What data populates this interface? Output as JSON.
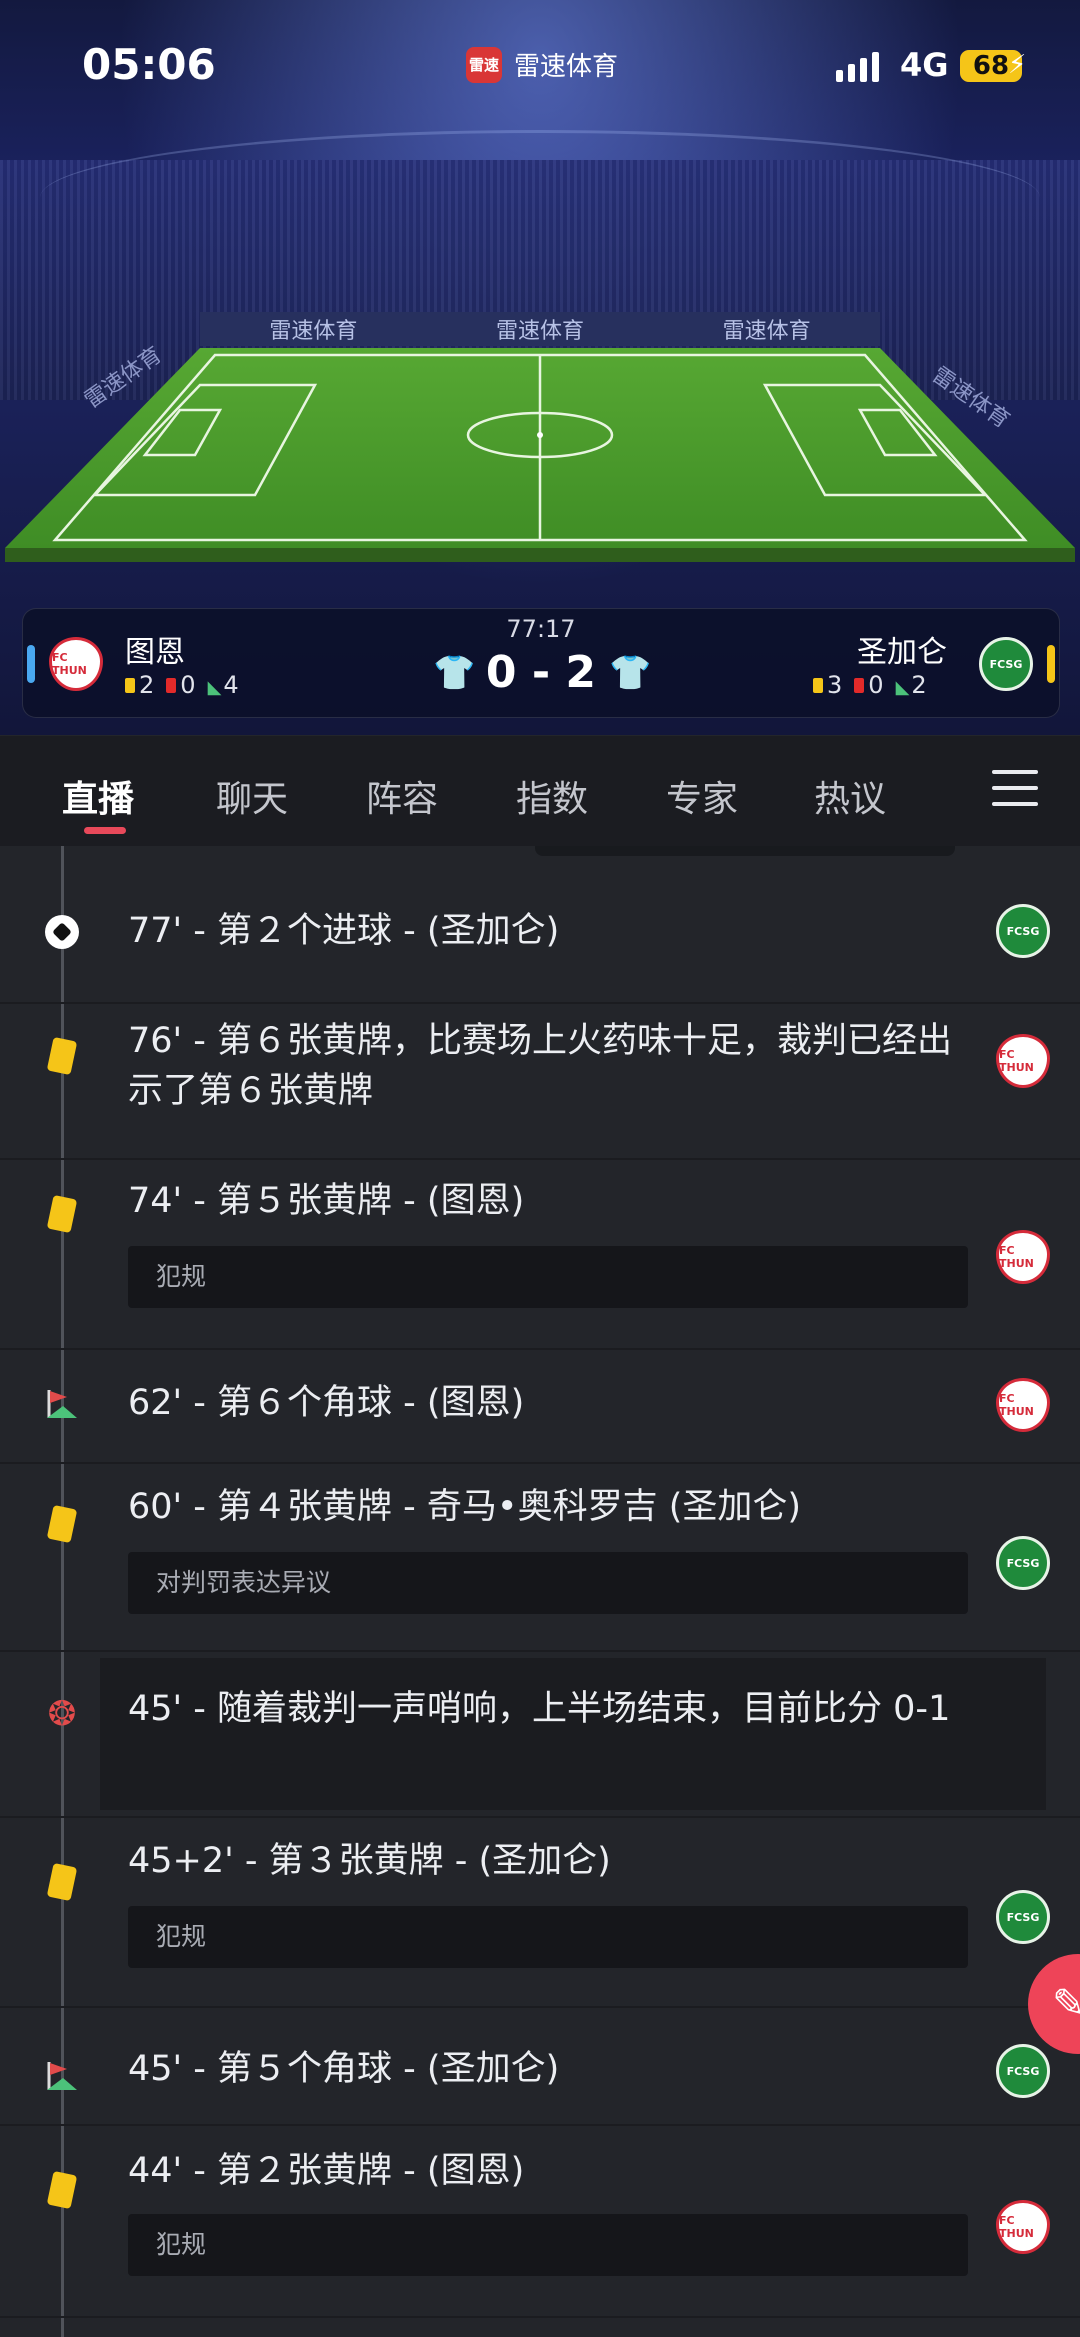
{
  "status_bar": {
    "time": "05:06",
    "network": "4G",
    "battery": "68"
  },
  "app": {
    "logo_text": "雷速",
    "name": "雷速体育"
  },
  "boards": {
    "ad": "雷速体育"
  },
  "match": {
    "clock": "77:17",
    "score": "0 - 2",
    "home": {
      "name": "图恩",
      "crest": "FC THUN",
      "yellow": "2",
      "red": "0",
      "corners": "4"
    },
    "away": {
      "name": "圣加仑",
      "crest": "FCSG",
      "yellow": "3",
      "red": "0",
      "corners": "2"
    }
  },
  "tabs": [
    "直播",
    "聊天",
    "阵容",
    "指数",
    "专家",
    "热议"
  ],
  "events": [
    {
      "icon": "soccer-ball-icon",
      "text": "77' - 第２个进球 - (圣加仑)",
      "team": "away"
    },
    {
      "icon": "yellow-card-icon",
      "text": "76' - 第６张黄牌，比赛场上火药味十足，裁判已经出示了第６张黄牌",
      "team": "home"
    },
    {
      "icon": "yellow-card-icon",
      "text": "74' - 第５张黄牌 - (图恩)",
      "note": "犯规",
      "team": "home"
    },
    {
      "icon": "corner-flag-icon",
      "text": "62' - 第６个角球 - (图恩)",
      "team": "home"
    },
    {
      "icon": "yellow-card-icon",
      "text": "60' - 第４张黄牌 - 奇马•奥科罗吉 (圣加仑)",
      "note": "对判罚表达异议",
      "team": "away"
    },
    {
      "icon": "whistle-icon",
      "text": "45' - 随着裁判一声哨响，上半场结束，目前比分 0-1"
    },
    {
      "icon": "yellow-card-icon",
      "text": "45+2' - 第３张黄牌 - (圣加仑)",
      "note": "犯规",
      "team": "away"
    },
    {
      "icon": "corner-flag-icon",
      "text": "45' - 第５个角球 - (圣加仑)",
      "team": "away"
    },
    {
      "icon": "yellow-card-icon",
      "text": "44' - 第２张黄牌 - (图恩)",
      "note": "犯规",
      "team": "home"
    }
  ]
}
